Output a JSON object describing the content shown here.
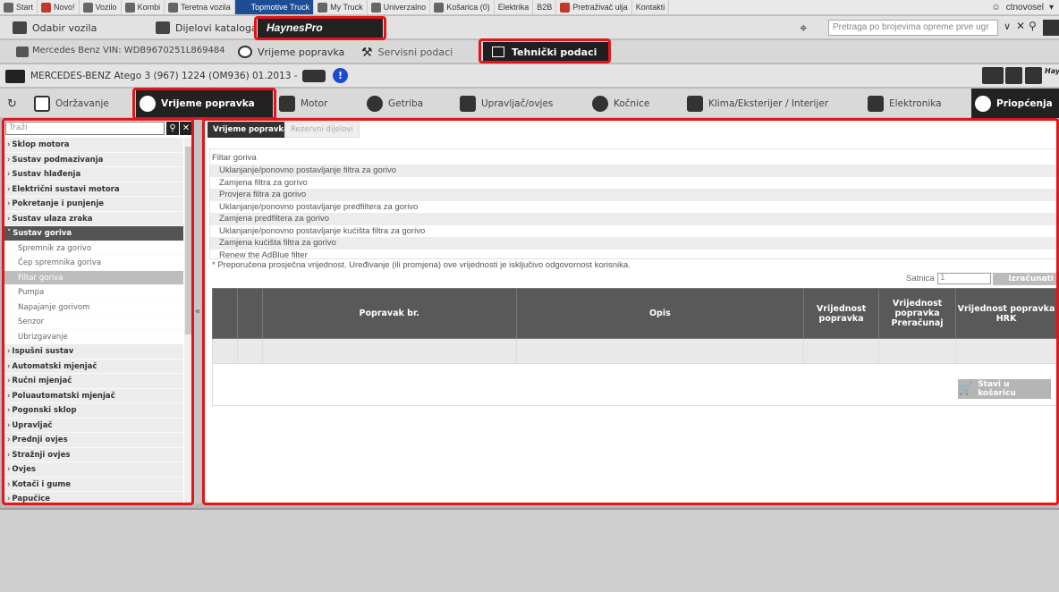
{
  "topnav": {
    "items": [
      {
        "label": "Start",
        "icon": "home-icon"
      },
      {
        "label": "Novo!",
        "icon": "new-icon"
      },
      {
        "label": "Vozilo",
        "icon": "car-icon"
      },
      {
        "label": "Kombi",
        "icon": "van-icon"
      },
      {
        "label": "Teretna vozila",
        "icon": "truck-icon"
      },
      {
        "label": "Topmotive Truck",
        "icon": "topmotive-truck-icon",
        "active": true
      },
      {
        "label": "My Truck",
        "icon": "my-truck-icon"
      },
      {
        "label": "Univerzalno",
        "icon": "universal-icon"
      },
      {
        "label": "Košarica (0)",
        "icon": "cart-icon"
      },
      {
        "label": "Elektrika",
        "icon": ""
      },
      {
        "label": "B2B",
        "icon": ""
      },
      {
        "label": "Pretraživač ulja",
        "icon": "oil-search-icon"
      },
      {
        "label": "Kontakti",
        "icon": ""
      }
    ],
    "user": "ctnovosel"
  },
  "toolbar": {
    "vehicle_select": "Odabir vozila",
    "catalog_parts": "Dijelovi kataloga",
    "haynes": "HaynesPro",
    "search_placeholder": "Pretraga po brojevima opreme prve ugr"
  },
  "vehicle_bar": {
    "vin": "Mercedes Benz VIN: WDB9670251L869484",
    "repair_times": "Vrijeme popravka",
    "service_data": "Servisni podaci",
    "technical_data": "Tehnički podaci"
  },
  "vehicle_title": "MERCEDES-BENZ Atego 3 (967) 1224 (OM936) 01.2013 -",
  "categories": [
    "Održavanje",
    "Vrijeme popravka",
    "Motor",
    "Getriba",
    "Upravljač/ovjes",
    "Kočnice",
    "Klima/Eksterijer / Interijer",
    "Elektronika",
    "Priopćenja"
  ],
  "sidebar": {
    "search_placeholder": "Traži",
    "items": [
      {
        "label": "Sklop motora",
        "kind": "group"
      },
      {
        "label": "Sustav podmazivanja",
        "kind": "group"
      },
      {
        "label": "Sustav hlađenja",
        "kind": "group"
      },
      {
        "label": "Električni sustavi motora",
        "kind": "group"
      },
      {
        "label": "Pokretanje i punjenje",
        "kind": "group"
      },
      {
        "label": "Sustav ulaza zraka",
        "kind": "group"
      },
      {
        "label": "Sustav goriva",
        "kind": "open"
      },
      {
        "label": "Spremnik za gorivo",
        "kind": "sub"
      },
      {
        "label": "Čep spremnika goriva",
        "kind": "sub"
      },
      {
        "label": "Filtar goriva",
        "kind": "subsel"
      },
      {
        "label": "Pumpa",
        "kind": "sub"
      },
      {
        "label": "Napajanje gorivom",
        "kind": "sub"
      },
      {
        "label": "Senzor",
        "kind": "sub"
      },
      {
        "label": "Ubrizgavanje",
        "kind": "sub"
      },
      {
        "label": "Ispušni sustav",
        "kind": "group"
      },
      {
        "label": "Automatski mjenjač",
        "kind": "group"
      },
      {
        "label": "Ručni mjenjač",
        "kind": "group"
      },
      {
        "label": "Poluautomatski mjenjač",
        "kind": "group"
      },
      {
        "label": "Pogonski sklop",
        "kind": "group"
      },
      {
        "label": "Upravljač",
        "kind": "group"
      },
      {
        "label": "Prednji ovjes",
        "kind": "group"
      },
      {
        "label": "Stražnji ovjes",
        "kind": "group"
      },
      {
        "label": "Ovjes",
        "kind": "group"
      },
      {
        "label": "Kotači i gume",
        "kind": "group"
      },
      {
        "label": "Papučice",
        "kind": "group"
      }
    ]
  },
  "main": {
    "tabs": [
      "Vrijeme popravka",
      "Rezervni dijelovi"
    ],
    "group_title": "Filtar goriva",
    "operations": [
      "Uklanjanje/ponovno postavljanje filtra za gorivo",
      "Zamjena filtra za gorivo",
      "Provjera filtra za gorivo",
      "Uklanjanje/ponovno postavljanje predfiltera za gorivo",
      "Zamjena predfiltera za gorivo",
      "Uklanjanje/ponovno postavljanje kućišta filtra za gorivo",
      "Zamjena kućišta filtra za gorivo",
      "Renew the AdBlue filter"
    ],
    "note": "* Preporučena prosječna vrijednost. Uređivanje (ili promjena) ove vrijednosti je isključivo odgovornost korisnika.",
    "satnica_label": "Satnica",
    "satnica_value": "1",
    "calculate": "Izračunati",
    "table_headers": [
      "",
      "",
      "Popravak br.",
      "Opis",
      "Vrijednost popravka",
      "Vrijednost popravka Preračunaj",
      "Vrijednost popravka HRK"
    ],
    "add_to_cart": "Stavi u košaricu"
  },
  "colors": {
    "highlight": "#e3151b",
    "active_nav": "#1d4e94",
    "dark": "#222222"
  }
}
